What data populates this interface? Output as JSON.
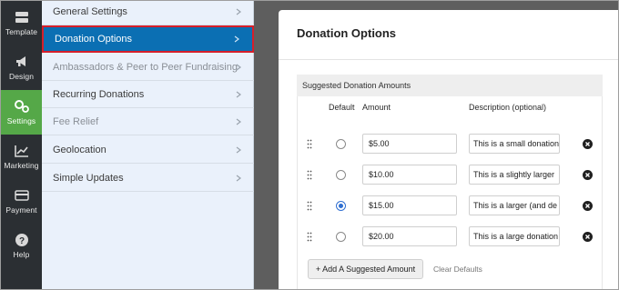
{
  "rail": {
    "items": [
      {
        "label": "Template",
        "icon": "template-icon"
      },
      {
        "label": "Design",
        "icon": "megaphone-icon"
      },
      {
        "label": "Settings",
        "icon": "gears-icon",
        "active": true
      },
      {
        "label": "Marketing",
        "icon": "chart-icon"
      },
      {
        "label": "Payment",
        "icon": "credit-card-icon"
      },
      {
        "label": "Help",
        "icon": "question-icon"
      }
    ]
  },
  "submenu": {
    "items": [
      {
        "label": "General Settings"
      },
      {
        "label": "Donation Options",
        "active": true
      },
      {
        "label": "Ambassadors & Peer to Peer Fundraising",
        "disabled": true
      },
      {
        "label": "Recurring Donations"
      },
      {
        "label": "Fee Relief",
        "disabled": true
      },
      {
        "label": "Geolocation"
      },
      {
        "label": "Simple Updates"
      }
    ]
  },
  "main": {
    "title": "Donation Options",
    "section": {
      "heading": "Suggested Donation Amounts",
      "columns": {
        "default": "Default",
        "amount": "Amount",
        "description": "Description (optional)"
      },
      "rows": [
        {
          "amount": "$5.00",
          "description": "This is a small donation",
          "default": false
        },
        {
          "amount": "$10.00",
          "description": "This is a slightly larger",
          "default": false
        },
        {
          "amount": "$15.00",
          "description": "This is a larger (and de",
          "default": true
        },
        {
          "amount": "$20.00",
          "description": "This is a large donation",
          "default": false
        }
      ],
      "add_button": "+ Add A Suggested Amount",
      "clear_link": "Clear Defaults"
    }
  },
  "colors": {
    "rail_bg": "#2b2f33",
    "rail_active": "#55a848",
    "submenu_bg": "#eaf1fb",
    "submenu_active": "#0b6fb3",
    "highlight_border": "#d61f2b",
    "radio_checked": "#2f6fd1"
  }
}
